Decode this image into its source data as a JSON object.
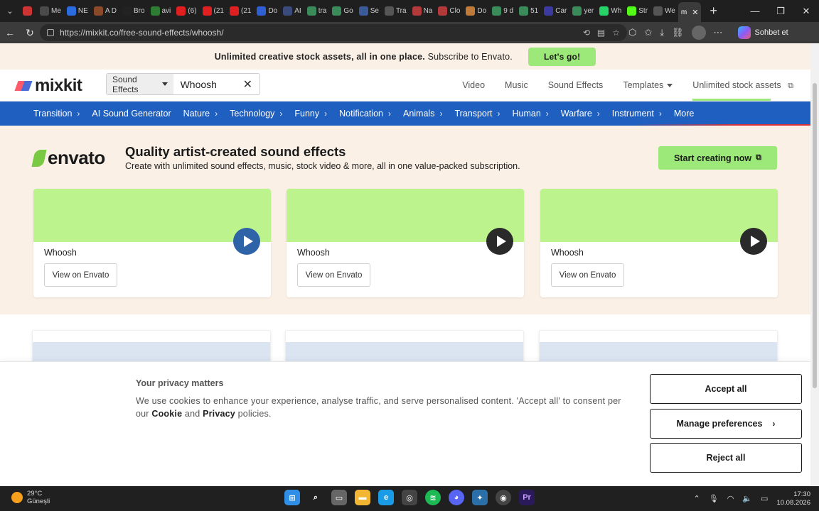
{
  "browser": {
    "tabs": [
      {
        "label": "",
        "color": "#cc3333"
      },
      {
        "label": "Me",
        "color": "#4a4a4a"
      },
      {
        "label": "NE",
        "color": "#2b6de0"
      },
      {
        "label": "A D",
        "color": "#8a4a2a"
      },
      {
        "label": "Bro",
        "color": "#222222"
      },
      {
        "label": "avi",
        "color": "#2e7d32"
      },
      {
        "label": "(6)",
        "color": "#e02020"
      },
      {
        "label": "(21",
        "color": "#e02020"
      },
      {
        "label": "(21",
        "color": "#e02020"
      },
      {
        "label": "Do",
        "color": "#2f5fd0"
      },
      {
        "label": "AI",
        "color": "#3a4a7a"
      },
      {
        "label": "tra",
        "color": "#3a8a5a"
      },
      {
        "label": "Go",
        "color": "#3a8a5a"
      },
      {
        "label": "Se",
        "color": "#3a5a9a"
      },
      {
        "label": "Tra",
        "color": "#555555"
      },
      {
        "label": "Na",
        "color": "#b33a3a"
      },
      {
        "label": "Clo",
        "color": "#b33a3a"
      },
      {
        "label": "Do",
        "color": "#c07a3a"
      },
      {
        "label": "9 d",
        "color": "#3a8a5a"
      },
      {
        "label": "51",
        "color": "#3a8a5a"
      },
      {
        "label": "Car",
        "color": "#3a3aa0"
      },
      {
        "label": "yer",
        "color": "#3a8a5a"
      },
      {
        "label": "Wh",
        "color": "#25d366"
      },
      {
        "label": "Str",
        "color": "#53fc18"
      },
      {
        "label": "We",
        "color": "#555555"
      }
    ],
    "active_tab_label": "m",
    "url": "https://mixkit.co/free-sound-effects/whoosh/",
    "copilot_label": "Sohbet et"
  },
  "promo": {
    "text_bold": "Unlimited creative stock assets, all in one place.",
    "text": "Subscribe to Envato.",
    "button": "Let's go!"
  },
  "header": {
    "logo": "mixkit",
    "search_category": "Sound Effects",
    "search_value": "Whoosh",
    "nav": [
      "Video",
      "Music",
      "Sound Effects",
      "Templates",
      "Unlimited stock assets"
    ]
  },
  "categories": [
    {
      "label": "Transition",
      "chev": true
    },
    {
      "label": "AI Sound Generator",
      "chev": false
    },
    {
      "label": "Nature",
      "chev": true
    },
    {
      "label": "Technology",
      "chev": true
    },
    {
      "label": "Funny",
      "chev": true
    },
    {
      "label": "Notification",
      "chev": true
    },
    {
      "label": "Animals",
      "chev": true
    },
    {
      "label": "Transport",
      "chev": true
    },
    {
      "label": "Human",
      "chev": true
    },
    {
      "label": "Warfare",
      "chev": true
    },
    {
      "label": "Instrument",
      "chev": true
    },
    {
      "label": "More",
      "chev": false
    }
  ],
  "envato": {
    "logo": "envato",
    "title": "Quality artist-created sound effects",
    "subtitle": "Create with unlimited sound effects, music, stock video & more, all in one value-packed subscription.",
    "cta": "Start creating now",
    "cards": [
      {
        "title": "Whoosh",
        "button": "View on Envato"
      },
      {
        "title": "Whoosh",
        "button": "View on Envato"
      },
      {
        "title": "Whoosh",
        "button": "View on Envato"
      }
    ]
  },
  "cookie": {
    "title": "Your privacy matters",
    "text_before": "We use cookies to enhance your experience, analyse traffic, and serve personalised content. 'Accept all' to consent per our",
    "cookie_link": "Cookie",
    "and": "and",
    "privacy_link": "Privacy",
    "text_after": "policies.",
    "accept": "Accept all",
    "manage": "Manage preferences",
    "reject": "Reject all"
  },
  "taskbar": {
    "temperature": "29°C",
    "weather": "Güneşli",
    "time": "17:30",
    "date": "10.08.2026"
  }
}
